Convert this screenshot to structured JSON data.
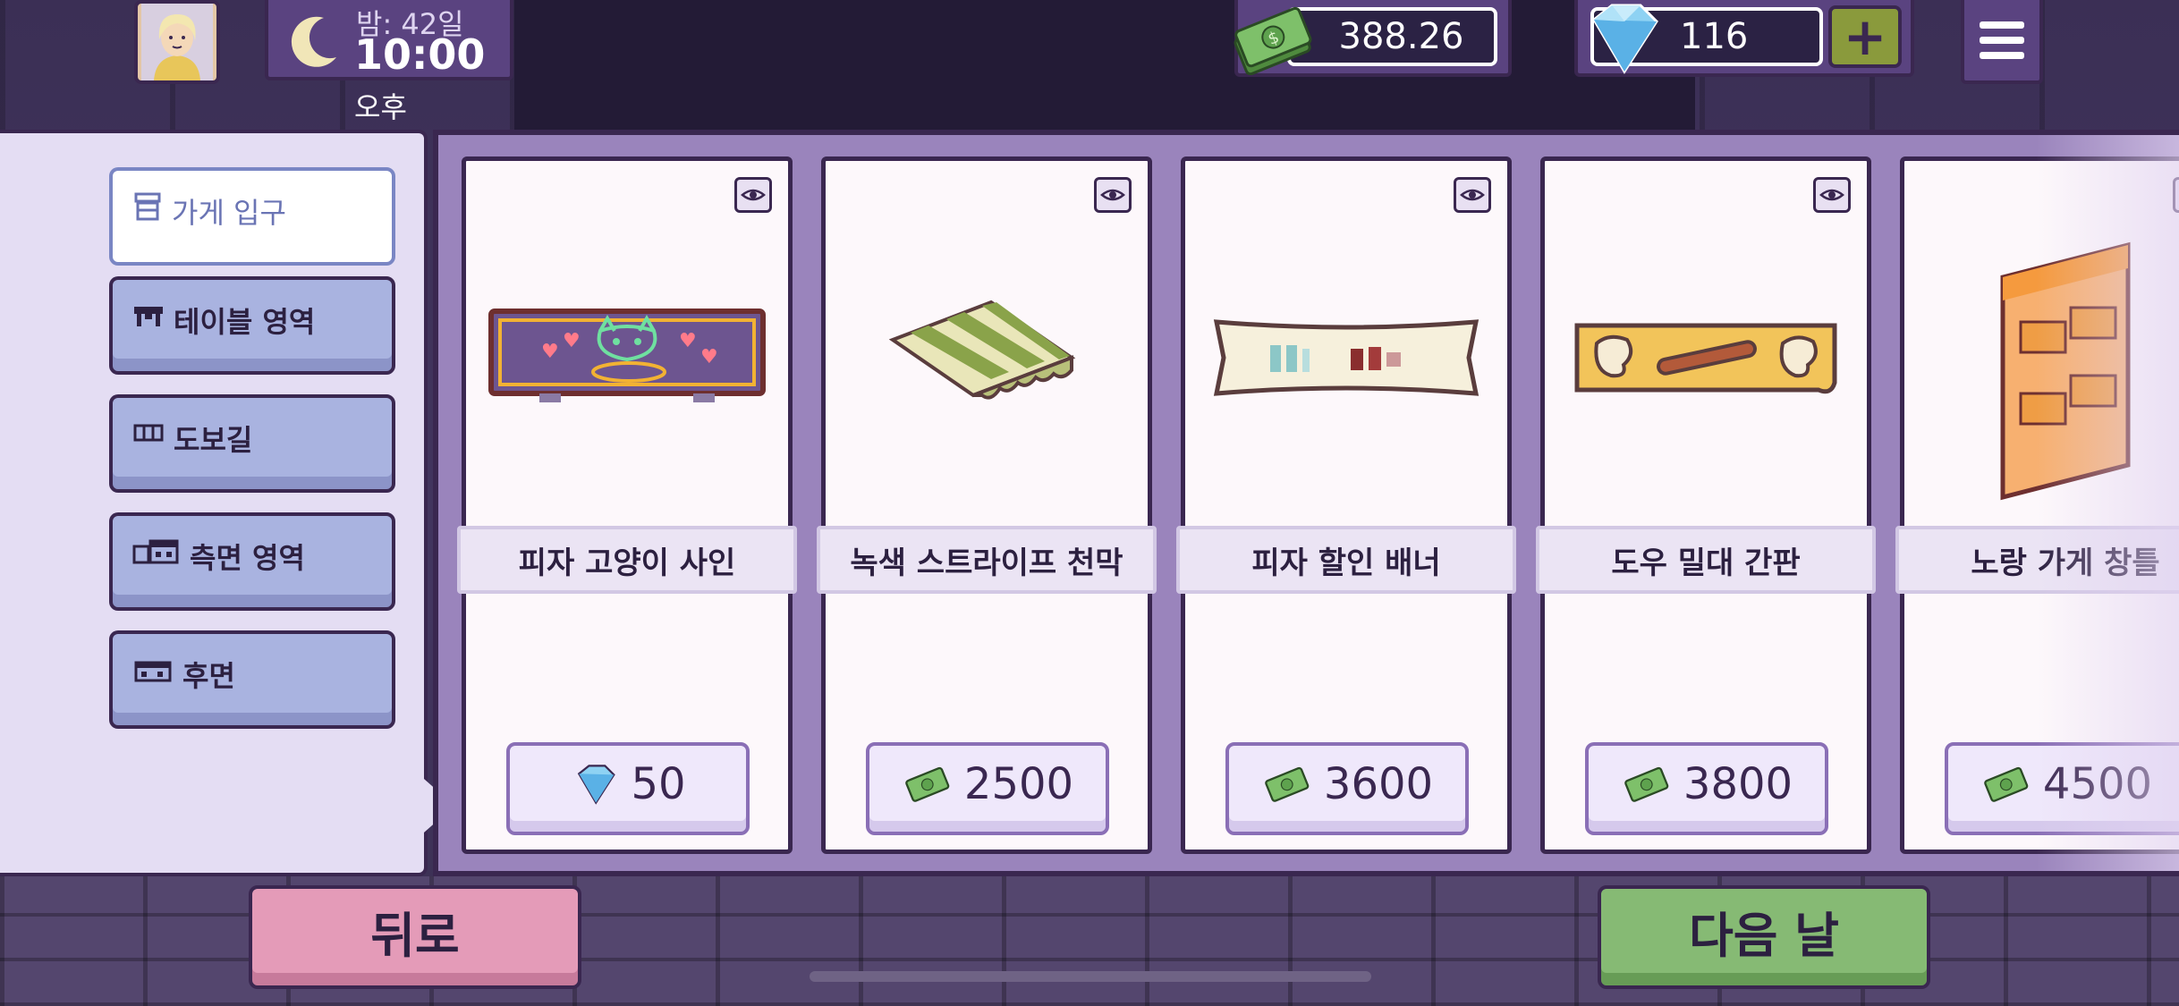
{
  "hud": {
    "day_text": "밤: 42일",
    "time_text": "10:00",
    "ampm_text": "오후",
    "money": "388.26",
    "gems": "116",
    "add_label": "+"
  },
  "sidebar": {
    "items": [
      {
        "label": "가게 입구",
        "icon": "storefront-icon",
        "active": true
      },
      {
        "label": "테이블 영역",
        "icon": "table-icon",
        "active": false
      },
      {
        "label": "도보길",
        "icon": "sidewalk-icon",
        "active": false
      },
      {
        "label": "측면 영역",
        "icon": "side-building-icon",
        "active": false
      },
      {
        "label": "후면",
        "icon": "back-building-icon",
        "active": false
      }
    ]
  },
  "shop": {
    "items": [
      {
        "name": "피자 고양이 사인",
        "price": "50",
        "currency": "gem"
      },
      {
        "name": "녹색 스트라이프 천막",
        "price": "2500",
        "currency": "cash"
      },
      {
        "name": "피자 할인 배너",
        "price": "3600",
        "currency": "cash"
      },
      {
        "name": "도우 밀대 간판",
        "price": "3800",
        "currency": "cash"
      },
      {
        "name": "노랑 가게 창틀",
        "price": "4500",
        "currency": "cash"
      }
    ]
  },
  "buttons": {
    "back": "뒤로",
    "next_day": "다음 날"
  },
  "colors": {
    "panel_purple": "#9a84bc",
    "back_pink": "#e49bb8",
    "next_green": "#86ba74",
    "outline": "#3a2750"
  }
}
